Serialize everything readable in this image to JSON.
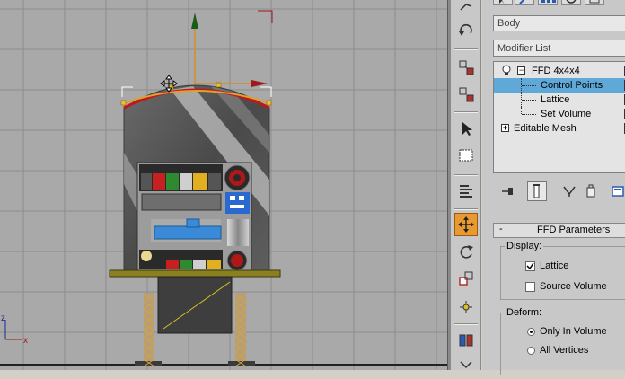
{
  "object_name": "Body",
  "modifier_list_label": "Modifier List",
  "stack": {
    "ffd": "FFD 4x4x4",
    "control_points": "Control Points",
    "lattice": "Lattice",
    "set_volume": "Set Volume",
    "editable_mesh": "Editable Mesh"
  },
  "rollout": {
    "title": "FFD Parameters",
    "display_label": "Display:",
    "lattice_label": "Lattice",
    "lattice_checked": true,
    "source_volume_label": "Source Volume",
    "source_volume_checked": false,
    "deform_label": "Deform:",
    "only_in_volume_label": "Only In Volume",
    "all_vertices_label": "All Vertices",
    "deform_selected": "Only In Volume"
  },
  "axis": {
    "z": "z",
    "x": "x"
  },
  "colors": {
    "viewport_bg": "#a9a9a9",
    "grid_line": "#8d8d8d",
    "selection_blue": "#5fa8d8",
    "active_tool": "#e89a30",
    "lattice_orange": "#e0a030"
  }
}
